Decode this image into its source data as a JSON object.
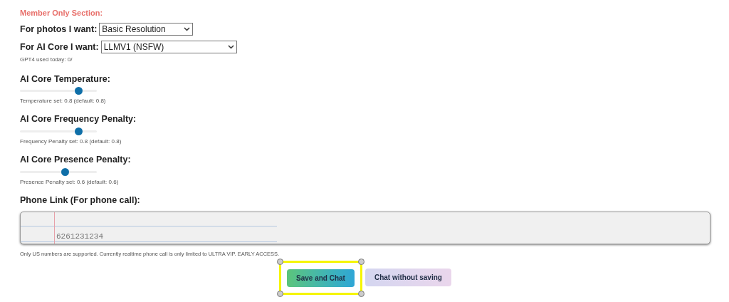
{
  "section_title": "Member Only Section:",
  "selects": [
    {
      "label": "For photos I want:",
      "value": "Basic Resolution"
    },
    {
      "label": "For AI Core I want:",
      "value": "LLMV1 (NSFW)"
    }
  ],
  "usage_note": "GPT4 used today: 0/",
  "sliders": [
    {
      "label": "AI Core Temperature:",
      "level": 0.8,
      "reading": "Temperature set: 0.8 (default: 0.8)"
    },
    {
      "label": "AI Core Frequency Penalty:",
      "level": 0.8,
      "reading": "Frequency Penalty set: 0.8 (default: 0.8)"
    },
    {
      "label": "AI Core Presence Penalty:",
      "level": 0.6,
      "reading": "Presence Penalty set: 0.6 (default: 0.6)"
    }
  ],
  "phone": {
    "label": "Phone Link (For phone call):",
    "value": "6261231234",
    "note": "Only US numbers are supported. Currently realtime phone call is only limited to ULTRA VIP. EARLY ACCESS."
  },
  "buttons": [
    {
      "label": "Save and Chat",
      "kind": "primary",
      "selected": true
    },
    {
      "label": "Chat without saving",
      "kind": "secondary",
      "selected": false
    }
  ]
}
